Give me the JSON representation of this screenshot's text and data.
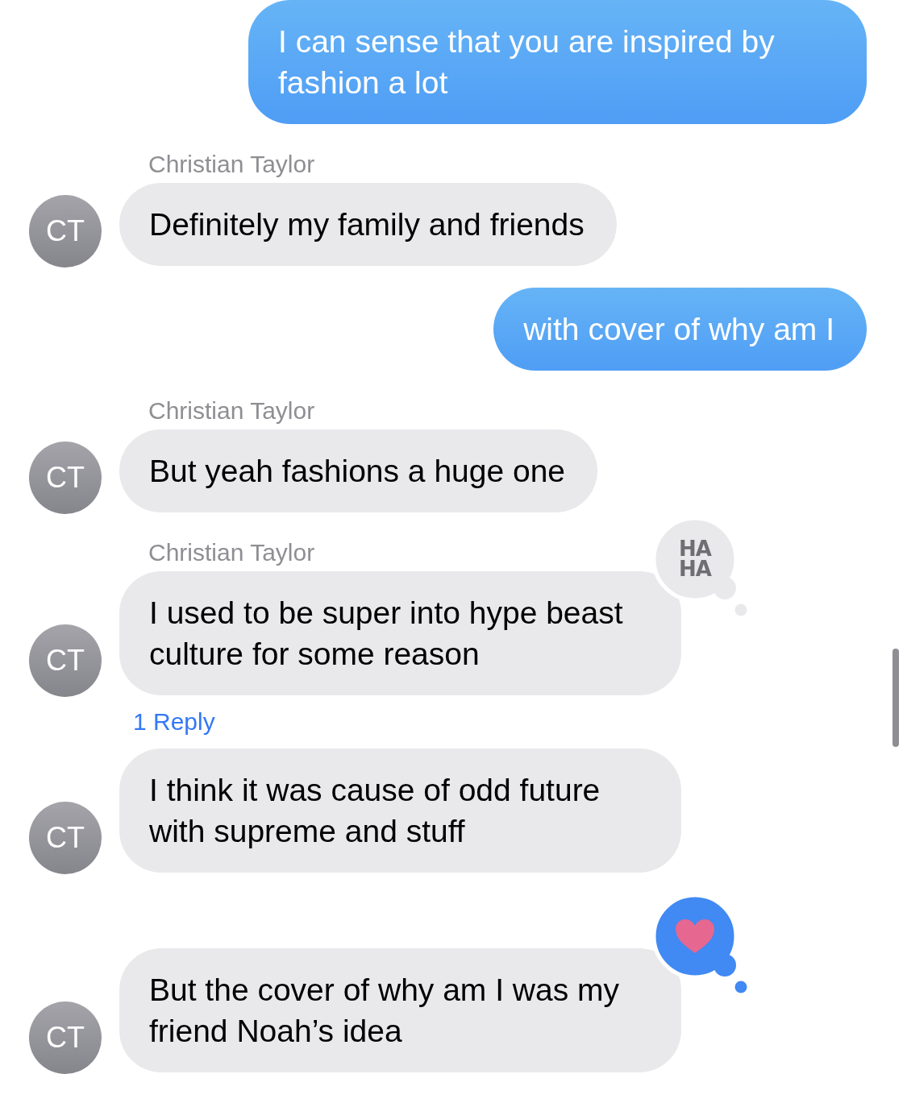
{
  "messages": [
    {
      "kind": "sent",
      "text": "I can sense that you are inspired by fashion a lot"
    },
    {
      "kind": "received",
      "sender": "Christian Taylor",
      "avatar": "CT",
      "text": "Definitely my family and friends"
    },
    {
      "kind": "sent",
      "text": "with cover of why am I"
    },
    {
      "kind": "received",
      "sender": "Christian Taylor",
      "avatar": "CT",
      "text": "But yeah fashions a huge one"
    },
    {
      "kind": "received",
      "sender": "Christian Taylor",
      "avatar": "CT",
      "text": "I used to be super into hype beast culture for some reason",
      "tapback": {
        "kind": "haha",
        "label": "HA HA",
        "mine": false
      }
    },
    {
      "kind": "reply",
      "text": "1 Reply"
    },
    {
      "kind": "received",
      "avatar": "CT",
      "text": "I think it was cause of odd future with supreme and stuff"
    },
    {
      "kind": "received",
      "avatar": "CT",
      "text": "But the cover of why am I was my friend Noah’s idea",
      "tapback": {
        "kind": "heart",
        "mine": true
      }
    }
  ]
}
